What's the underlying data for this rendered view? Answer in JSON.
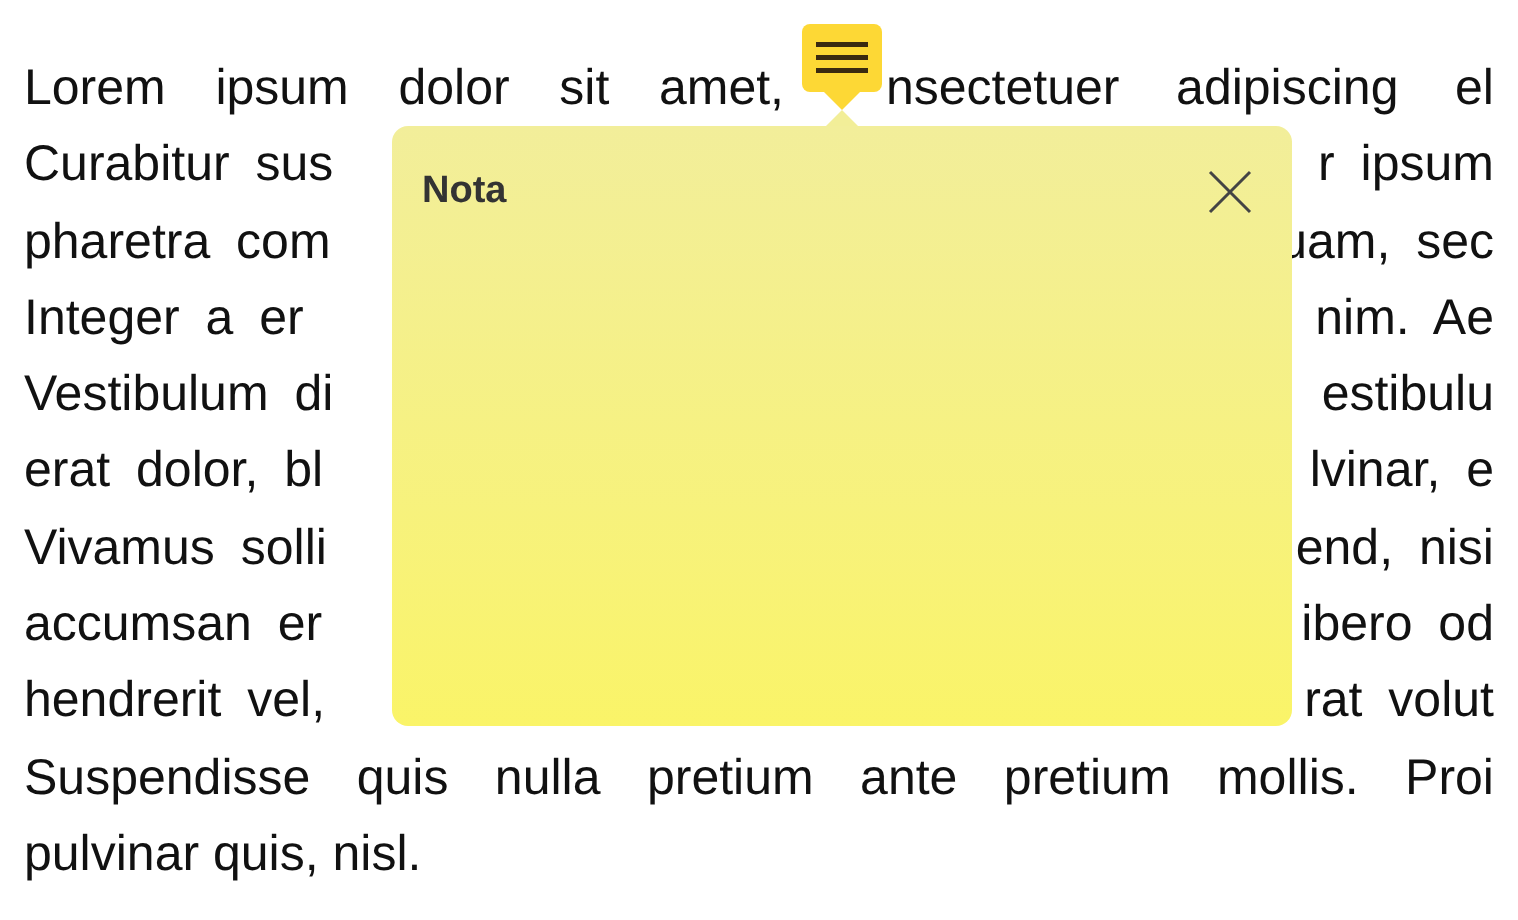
{
  "paragraph": {
    "lines": [
      {
        "kind": "gap",
        "left": "Lorem ipsum dolor sit amet,",
        "right": "nsectetuer adipiscing el"
      },
      {
        "kind": "split",
        "left": "Curabitur sus",
        "right": "r ipsum"
      },
      {
        "kind": "split",
        "left": "pharetra com",
        "right": "uam, sec"
      },
      {
        "kind": "split",
        "left": "Integer a er",
        "right": "nim. Ae"
      },
      {
        "kind": "split",
        "left": "Vestibulum di",
        "right": "estibulu"
      },
      {
        "kind": "split",
        "left": "erat dolor, bl",
        "right": "lvinar, e"
      },
      {
        "kind": "split",
        "left": "Vivamus solli",
        "right": "end, nisi"
      },
      {
        "kind": "split",
        "left": "accumsan er",
        "right": "ibero od"
      },
      {
        "kind": "split",
        "left": "hendrerit vel,",
        "right": "rat volut"
      },
      {
        "kind": "full",
        "text": "Suspendisse quis nulla pretium ante pretium mollis. Proi"
      },
      {
        "kind": "last",
        "text": "pulvinar quis, nisl."
      }
    ]
  },
  "note": {
    "title": "Nota"
  }
}
